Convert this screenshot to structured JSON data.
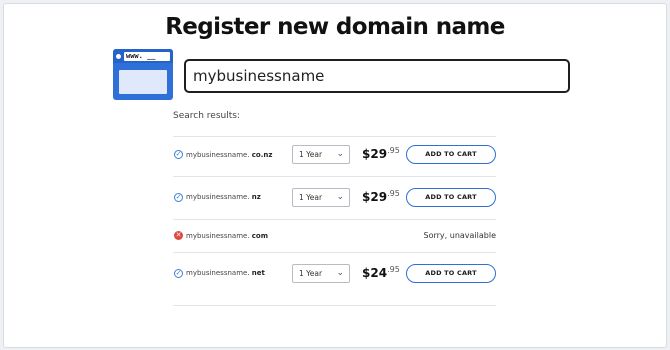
{
  "page": {
    "title": "Register new domain name",
    "icon": "browser-window-icon",
    "icon_url_text": "www. __"
  },
  "search": {
    "value": "mybusinessname"
  },
  "results": {
    "label": "Search results:",
    "items": [
      {
        "name": "mybusinessname.",
        "tld": "co.nz",
        "available": true,
        "term": "1 Year",
        "price_dollars": "$29",
        "price_cents": ".95",
        "cart_label": "ADD TO CART"
      },
      {
        "name": "mybusinessname.",
        "tld": "nz",
        "available": true,
        "term": "1 Year",
        "price_dollars": "$29",
        "price_cents": ".95",
        "cart_label": "ADD TO CART"
      },
      {
        "name": "mybusinessname.",
        "tld": "com",
        "available": false,
        "status_text": "Sorry, unavailable"
      },
      {
        "name": "mybusinessname.",
        "tld": "net",
        "available": true,
        "term": "1 Year",
        "price_dollars": "$24",
        "price_cents": ".95",
        "cart_label": "ADD TO CART"
      }
    ]
  },
  "colors": {
    "accent": "#2e6fd8",
    "available": "#3d7edb",
    "unavailable": "#e0473b"
  }
}
